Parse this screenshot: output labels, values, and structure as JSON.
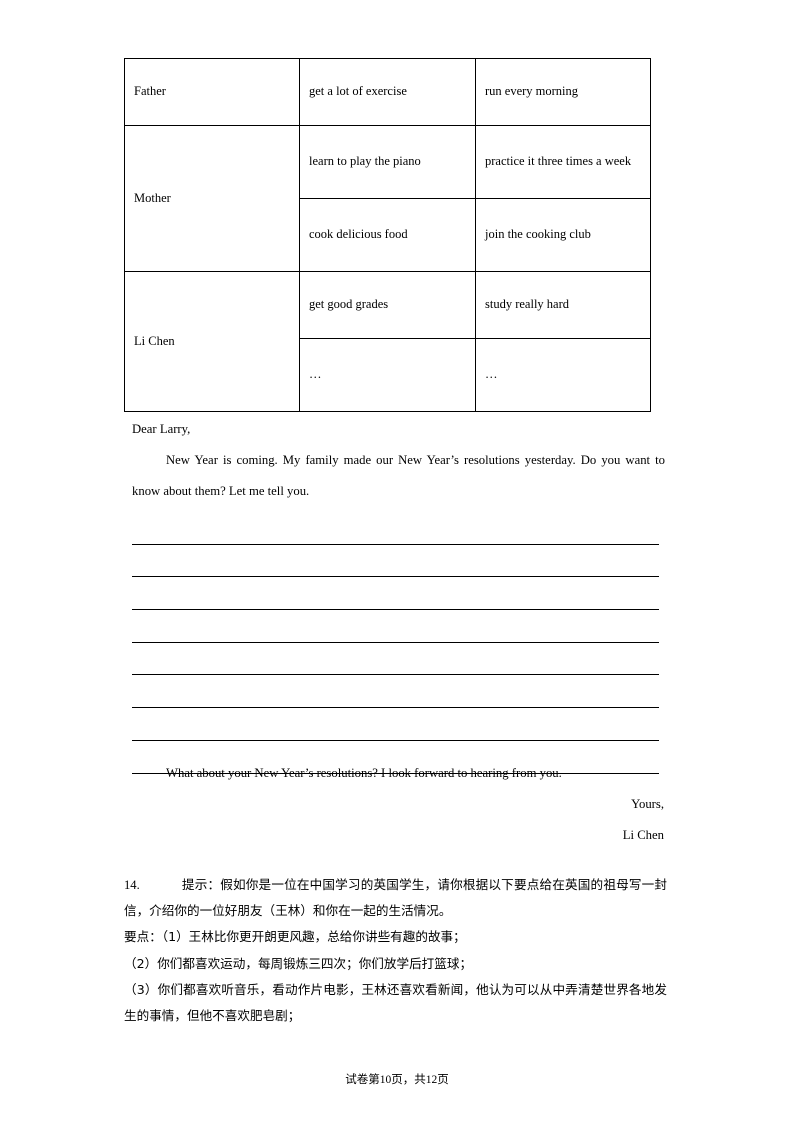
{
  "table": {
    "rows": [
      {
        "person": "Father",
        "person_rowspan": 1,
        "items": [
          {
            "goal": "get a lot of exercise",
            "how": "run every morning"
          }
        ]
      },
      {
        "person": "Mother",
        "person_rowspan": 2,
        "items": [
          {
            "goal": "learn to play the piano",
            "how": "practice it three times a week"
          },
          {
            "goal": "cook delicious food",
            "how": "join the cooking club"
          }
        ]
      },
      {
        "person": "Li Chen",
        "person_rowspan": 2,
        "items": [
          {
            "goal": "get good grades",
            "how": "study really hard"
          },
          {
            "goal": "…",
            "how": "…"
          }
        ]
      }
    ]
  },
  "letter": {
    "salutation": "Dear Larry,",
    "body": "New Year is coming. My family made our New Year’s resolutions yesterday. Do you want to know about them? Let me tell you.",
    "blank_line_count": 8,
    "closing_sentence": "What about your New Year’s resolutions? I look forward to hearing from you.",
    "sign_off": "Yours,",
    "signature": "Li Chen"
  },
  "question": {
    "number": "14.",
    "lead": "提示：假如你是一位在中国学习的英国学生，请你根据以下要点给在英国的祖母写一封信，介绍你的一位好朋友（王林）和你在一起的生活情况。",
    "points": [
      "要点：（1）王林比你更开朗更风趣，总给你讲些有趣的故事；",
      "（2）你们都喜欢运动，每周锻炼三四次；你们放学后打篮球；",
      "（3）你们都喜欢听音乐，看动作片电影，王林还喜欢看新闻，他认为可以从中弄清楚世界各地发生的事情，但他不喜欢肥皂剧；"
    ]
  },
  "footer": {
    "prefix": "试卷第",
    "current_page": "10",
    "middle": "页，共",
    "total_pages": "12",
    "suffix": "页"
  }
}
